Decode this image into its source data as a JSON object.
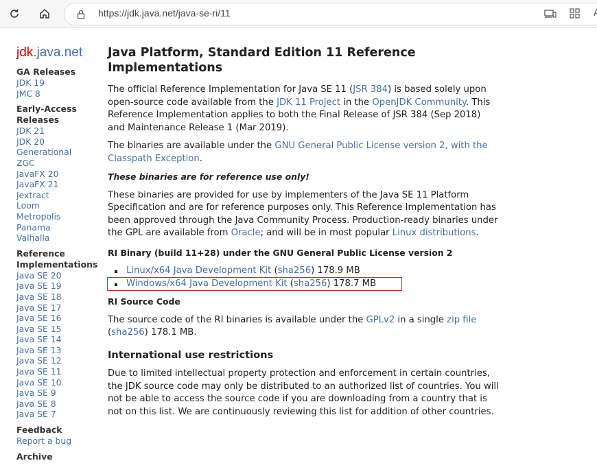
{
  "browser": {
    "url": "https://jdk.java.net/java-se-ri/11",
    "read_aloud_glyph": "A"
  },
  "sidebar": {
    "logo_prefix": "jdk",
    "logo_suffix": ".java.net",
    "sections": [
      {
        "heading": "GA Releases",
        "links": [
          "JDK 19",
          "JMC 8"
        ]
      },
      {
        "heading": "Early-Access Releases",
        "links": [
          "JDK 21",
          "JDK 20",
          "Generational ZGC",
          "JavaFX 20",
          "JavaFX 21",
          "Jextract",
          "Loom",
          "Metropolis",
          "Panama",
          "Valhalla"
        ]
      },
      {
        "heading": "Reference Implementations",
        "links": [
          "Java SE 20",
          "Java SE 19",
          "Java SE 18",
          "Java SE 17",
          "Java SE 16",
          "Java SE 15",
          "Java SE 14",
          "Java SE 13",
          "Java SE 12",
          "Java SE 11",
          "Java SE 10",
          "Java SE 9",
          "Java SE 8",
          "Java SE 7"
        ]
      },
      {
        "heading": "Feedback",
        "links": [
          "Report a bug"
        ]
      },
      {
        "heading": "Archive",
        "links": []
      }
    ]
  },
  "main": {
    "title": "Java Platform, Standard Edition 11 Reference Implementations",
    "intro": {
      "t1": "The official Reference Implementation for Java SE 11 (",
      "jsr": "JSR 384",
      "t2": ") is based solely upon open-source code available from the ",
      "project": "JDK 11 Project",
      "t3": " in the ",
      "community": "OpenJDK Community",
      "t4": ". This Reference Implementation applies to both the Final Release of JSR 384 (Sep 2018) and Maintenance Release 1 (Mar 2019)."
    },
    "license": {
      "t1": "The binaries are available under the ",
      "gpl": "GNU General Public License version 2, with the Classpath Exception",
      "t2": "."
    },
    "warning": "These binaries are for reference use only!",
    "usage": {
      "t1": "These binaries are provided for use by implementers of the Java SE 11 Platform Specification and are for reference purposes only. This Reference Implementation has been approved through the Java Community Process. Production-ready binaries under the GPL are available from ",
      "oracle": "Oracle",
      "t2": "; and will be in most popular ",
      "linux": "Linux distributions",
      "t3": "."
    },
    "binary_heading": "RI Binary (build 11+28) under the GNU General Public License version 2",
    "downloads": [
      {
        "name": "Linux/x64 Java Development Kit",
        "open": " (",
        "sha": "sha256",
        "size": ") 178.9 MB"
      },
      {
        "name": "Windows/x64 Java Development Kit",
        "open": " (",
        "sha": "sha256",
        "size": ") 178.7 MB"
      }
    ],
    "source_heading": "RI Source Code",
    "source": {
      "t1": "The source code of the RI binaries is available under the ",
      "gplv2": "GPLv2",
      "t2": " in a single ",
      "zip": "zip file",
      "t3": " (",
      "sha": "sha256",
      "t4": ") 178.1 MB."
    },
    "intl_heading": "International use restrictions",
    "intl_text": "Due to limited intellectual property protection and enforcement in certain countries, the JDK source code may only be distributed to an authorized list of countries. You will not be able to access the source code if you are downloading from a country that is not on this list. We are continuously reviewing this list for addition of other countries."
  },
  "colors": {
    "link": "#4470a8",
    "logo_red": "#cc0000",
    "highlight": "#dd2222"
  }
}
